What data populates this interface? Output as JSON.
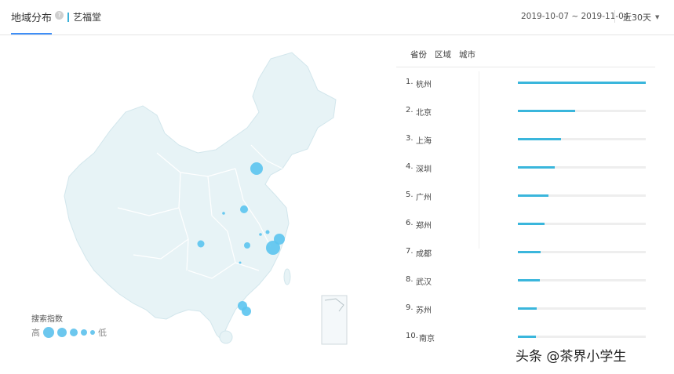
{
  "header": {
    "tab_label": "地域分布",
    "info_icon": "?",
    "keyword": "艺福堂",
    "date_range": "2019-10-07 ~ 2019-11-04",
    "period": "近30天",
    "period_caret": "▼"
  },
  "filters": [
    "省份",
    "区域",
    "城市"
  ],
  "legend": {
    "title": "搜索指数",
    "high": "高",
    "low": "低"
  },
  "ranking": [
    {
      "num": "1.",
      "name": "杭州",
      "value": 1.0
    },
    {
      "num": "2.",
      "name": "北京",
      "value": 0.45
    },
    {
      "num": "3.",
      "name": "上海",
      "value": 0.34
    },
    {
      "num": "4.",
      "name": "深圳",
      "value": 0.29
    },
    {
      "num": "5.",
      "name": "广州",
      "value": 0.24
    },
    {
      "num": "6.",
      "name": "郑州",
      "value": 0.21
    },
    {
      "num": "7.",
      "name": "成都",
      "value": 0.18
    },
    {
      "num": "8.",
      "name": "武汉",
      "value": 0.17
    },
    {
      "num": "9.",
      "name": "苏州",
      "value": 0.15
    },
    {
      "num": "10.",
      "name": "南京",
      "value": 0.14
    }
  ],
  "watermark": "头条 @茶界小学生",
  "colors": {
    "accent": "#3ab6dc",
    "tab_underline": "#3e8ef7",
    "map_fill": "#e7f3f6",
    "bubble": "#5bc4ef"
  },
  "icons": {
    "info": "info-icon",
    "caret": "caret-down-icon"
  }
}
